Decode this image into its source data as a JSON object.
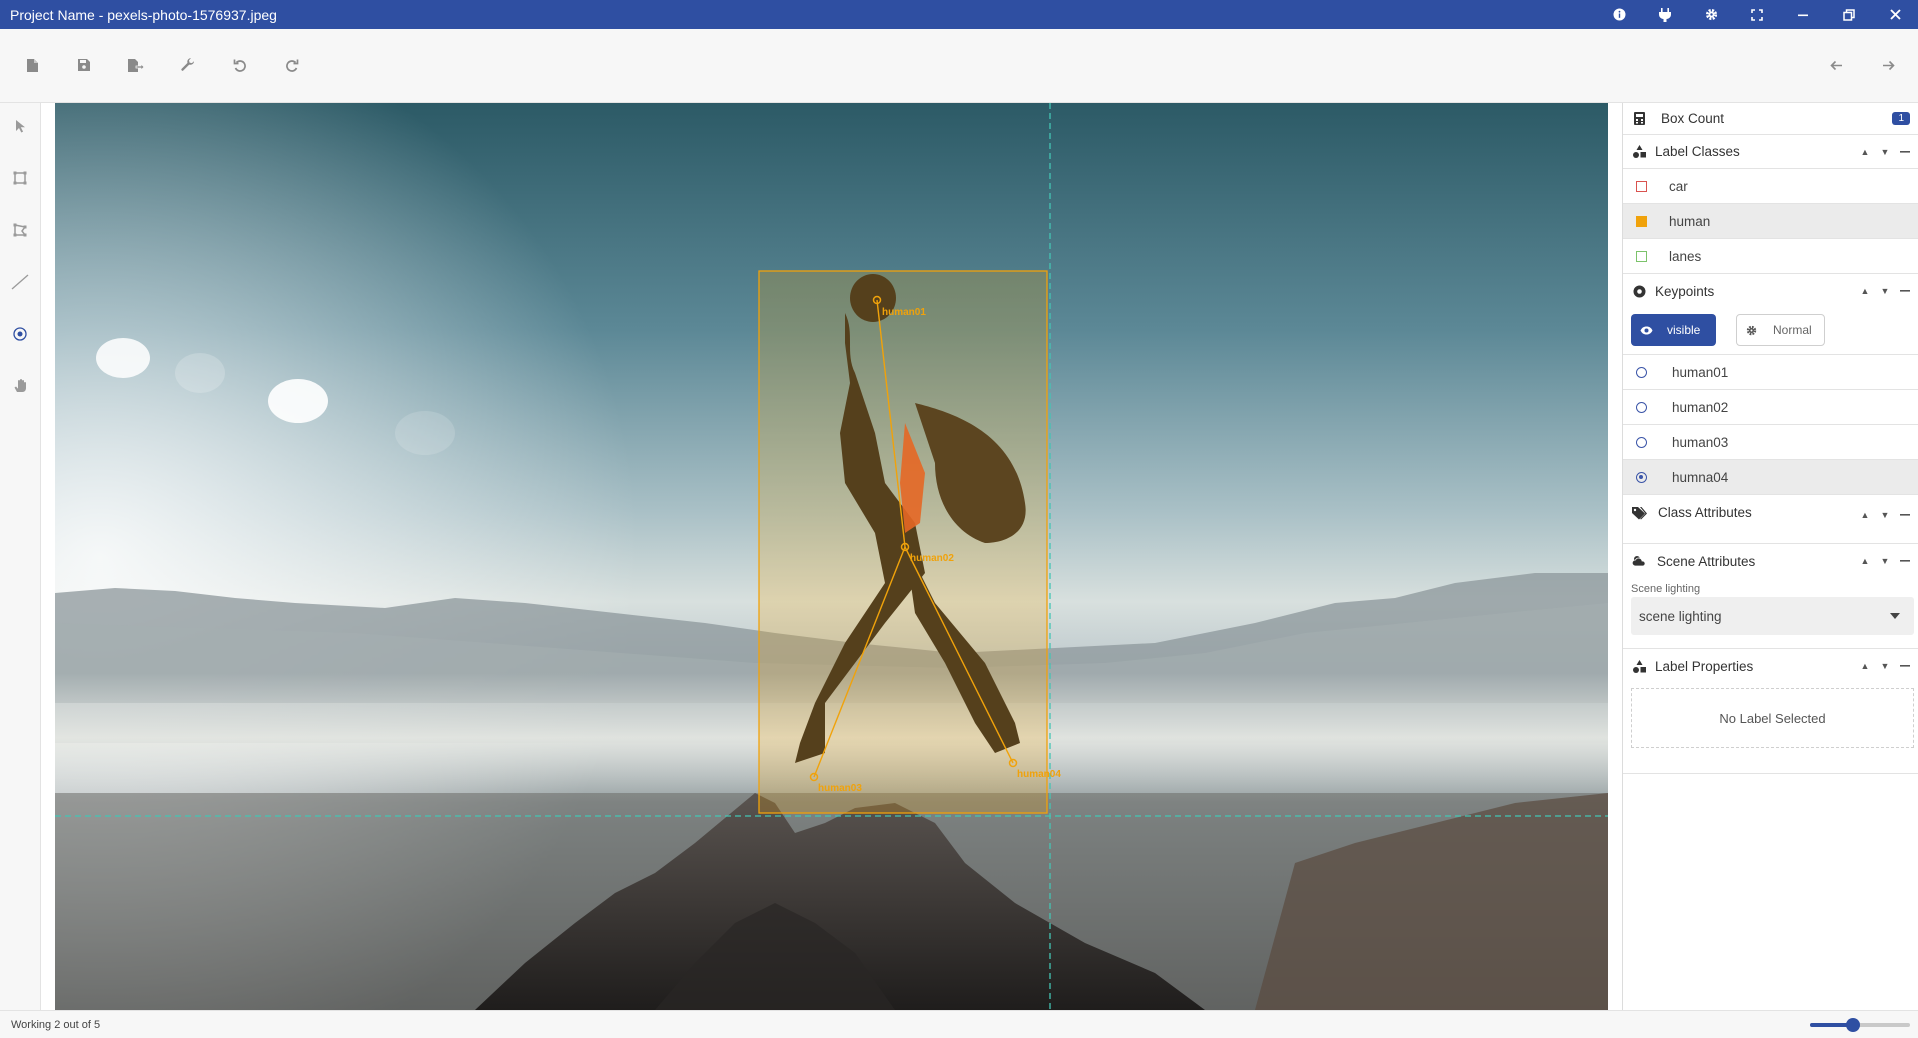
{
  "window": {
    "title": "Project Name - pexels-photo-1576937.jpeg",
    "buttons": [
      "info-icon",
      "plug-icon",
      "gear-icon",
      "fullscreen-icon",
      "minimize-icon",
      "restore-icon",
      "close-icon"
    ]
  },
  "toolbar": {
    "left": [
      "new-file-icon",
      "save-icon",
      "export-icon",
      "wrench-icon",
      "undo-icon",
      "redo-icon"
    ],
    "right": [
      "arrow-left-icon",
      "arrow-right-icon"
    ]
  },
  "tools": [
    "pointer-icon",
    "bounding-box-icon",
    "polygon-icon",
    "line-icon",
    "keypoint-icon",
    "hand-icon"
  ],
  "canvas": {
    "keypoint_labels": [
      "human01",
      "human02",
      "human03",
      "human04"
    ]
  },
  "panel": {
    "box_count": {
      "label": "Box Count",
      "value": "1"
    },
    "label_classes": {
      "title": "Label Classes",
      "items": [
        {
          "name": "car",
          "color": "#d9534f",
          "selected": false
        },
        {
          "name": "human",
          "color": "#f0a20b",
          "selected": true
        },
        {
          "name": "lanes",
          "color": "#7cc36b",
          "selected": false
        }
      ]
    },
    "keypoints": {
      "title": "Keypoints",
      "visible_label": "visible",
      "normal_label": "Normal",
      "items": [
        {
          "name": "human01",
          "active": false
        },
        {
          "name": "human02",
          "active": false
        },
        {
          "name": "human03",
          "active": false
        },
        {
          "name": "humna04",
          "active": true
        }
      ]
    },
    "class_attributes": {
      "title": "Class Attributes"
    },
    "scene_attributes": {
      "title": "Scene Attributes",
      "field_label": "Scene lighting",
      "field_value": "scene lighting"
    },
    "label_properties": {
      "title": "Label Properties",
      "empty_text": "No Label Selected"
    }
  },
  "status": {
    "text": "Working 2 out of 5",
    "zoom_fraction": 0.43
  },
  "colors": {
    "accent": "#2f4fa2",
    "annotation": "#f0a20b",
    "guide": "#43c5b4"
  }
}
